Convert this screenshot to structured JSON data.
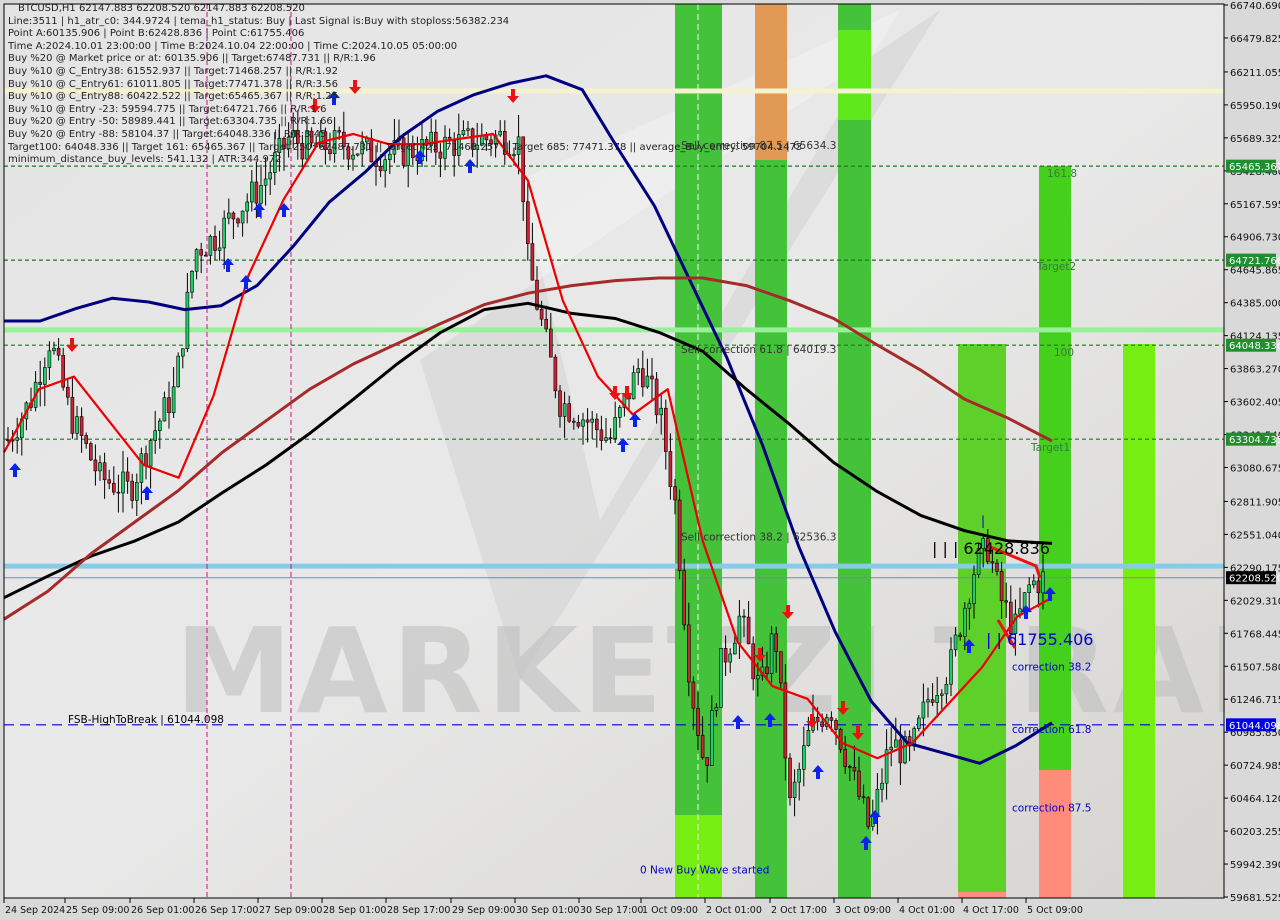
{
  "window": {
    "symbol_line": "BTCUSD,H1  62147.883 62208.520 62147.883 62208.520"
  },
  "info_lines": [
    "Line:3511 | h1_atr_c0: 344.9724 | tema_h1_status: Buy | Last Signal is:Buy with stoploss:56382.234",
    "Point A:60135.906 | Point B:62428.836 | Point C:61755.406",
    "Time A:2024.10.01 23:00:00 | Time B:2024.10.04 22:00:00 | Time C:2024.10.05 05:00:00",
    "Buy %20 @ Market price or at: 60135.906 || Target:67487.731 || R/R:1.96",
    "Buy %10 @ C_Entry38: 61552.937 || Target:71468.257 || R/R:1.92",
    "Buy %10 @ C_Entry61: 61011.805 || Target:77471.378 || R/R:3.56",
    "Buy %10 @ C_Entry88: 60422.522 || Target:65465.367 || R/R:1.25",
    "Buy %10 @ Entry -23: 59594.775 || Target:64721.766 || R/R:1.6",
    "Buy %20 @ Entry -50: 58989.441 || Target:63304.735 || R/R:1.66",
    "Buy %20 @ Entry -88: 58104.37 || Target:64048.336 || R/R:3.45",
    "Target100: 64048.336 || Target 161: 65465.367 || Target 250: 67487.731 || Target 423: 71468.257 || Target 685: 77471.378 || average_Buy_entry: 59704.1473",
    "minimum_distance_buy_levels: 541.132 | ATR:344.972"
  ],
  "chart_data": {
    "type": "candlestick",
    "title": "BTCUSD,H1",
    "symbol": "BTCUSD",
    "timeframe": "H1",
    "ohlc_last": {
      "open": 62147.883,
      "high": 62208.52,
      "low": 62147.883,
      "close": 62208.52
    },
    "ylim": [
      59600,
      66800
    ],
    "y_ticks": [
      "66740.690",
      "66479.825",
      "66211.055",
      "65950.190",
      "65689.325",
      "65428.460",
      "65167.595",
      "64906.730",
      "64645.865",
      "64385.000",
      "64124.135",
      "63863.270",
      "63602.405",
      "63341.540",
      "63080.675",
      "62811.905",
      "62551.040",
      "62290.175",
      "62029.310",
      "61768.445",
      "61507.580",
      "61246.715",
      "60985.850",
      "60724.985",
      "60464.120",
      "60203.255",
      "59942.390",
      "59681.525"
    ],
    "x_ticks": [
      "24 Sep 2024",
      "25 Sep 09:00",
      "26 Sep 01:00",
      "26 Sep 17:00",
      "27 Sep 09:00",
      "28 Sep 01:00",
      "28 Sep 17:00",
      "29 Sep 09:00",
      "30 Sep 01:00",
      "30 Sep 17:00",
      "1 Oct 09:00",
      "2 Oct 01:00",
      "2 Oct 17:00",
      "3 Oct 09:00",
      "4 Oct 01:00",
      "4 Oct 17:00",
      "5 Oct 09:00"
    ],
    "price_labels": [
      {
        "value": 65465.367,
        "text": "65465.367",
        "color": "#1f8f2e"
      },
      {
        "value": 64721.766,
        "text": "64721.766",
        "color": "#1f8f2e"
      },
      {
        "value": 64048.336,
        "text": "64048.336",
        "color": "#1f8f2e"
      },
      {
        "value": 63304.735,
        "text": "63304.735",
        "color": "#1f8f2e"
      },
      {
        "value": 62208.52,
        "text": "62208.520",
        "color": "#000000"
      },
      {
        "value": 61044.098,
        "text": "61044.098",
        "color": "#0000ee"
      }
    ],
    "horizontal_lines": [
      {
        "name": "target-161",
        "value": 65465.367,
        "style": "dashed",
        "color": "#1a7a1a"
      },
      {
        "name": "target-2",
        "value": 64721.766,
        "style": "dashed",
        "color": "#1a7a1a"
      },
      {
        "name": "target-100",
        "value": 64048.336,
        "style": "dashed",
        "color": "#1a7a1a"
      },
      {
        "name": "target-1",
        "value": 63304.735,
        "style": "dashed",
        "color": "#1a7a1a"
      },
      {
        "name": "fsb-high-to-break",
        "value": 61044.098,
        "style": "dashed",
        "color": "#0000cc"
      },
      {
        "name": "current-price",
        "value": 62208.52,
        "style": "solid",
        "color": "#7788aa"
      },
      {
        "name": "cream-level",
        "value": 66060,
        "style": "thick",
        "color": "#f5f2d0"
      },
      {
        "name": "lightgreen-level",
        "value": 64170,
        "style": "thick",
        "color": "#98f098"
      },
      {
        "name": "skyblue-level",
        "value": 62300,
        "style": "thick",
        "color": "#87cbe8"
      }
    ],
    "annotations": [
      {
        "text": "Sell correction 87.5 | 65634.3",
        "value": 65634.3,
        "color": "#333333"
      },
      {
        "text": "Sell correction 61.8 | 64019.3",
        "value": 64019.3,
        "color": "#333333"
      },
      {
        "text": "Sell correction 38.2 | 62536.3",
        "value": 62536.3,
        "color": "#333333"
      },
      {
        "text": "161.8",
        "value": 65465.367,
        "color": "#3a7a3a"
      },
      {
        "text": "Target2",
        "value": 64721.766,
        "color": "#3a7a3a"
      },
      {
        "text": "100",
        "value": 64048.336,
        "color": "#3a7a3a"
      },
      {
        "text": "Target1",
        "value": 63304.735,
        "color": "#3a7a3a"
      },
      {
        "text": "| | | 62428.836",
        "value": 62428.836,
        "color": "#000000"
      },
      {
        "text": "| | 61755.406",
        "value": 61755.406,
        "color": "#0000cc"
      },
      {
        "text": "correction 38.2",
        "value": 61552.937,
        "color": "#0000cc"
      },
      {
        "text": "correction 61.8",
        "value": 61011.805,
        "color": "#0000cc"
      },
      {
        "text": "correction 87.5",
        "value": 60422.522,
        "color": "#0000cc"
      },
      {
        "text": "FSB-HighToBreak | 61044.098",
        "value": 61044.098,
        "color": "#000000"
      },
      {
        "text": "0 New Buy Wave started",
        "value": 59900,
        "color": "#0000cc"
      }
    ],
    "series": [
      {
        "name": "ma-blue",
        "color": "#000080",
        "values": [
          64240,
          64240,
          64340,
          64420,
          64390,
          64330,
          64360,
          64520,
          64830,
          65180,
          65420,
          65700,
          65900,
          66030,
          66120,
          66180,
          66070,
          65600,
          65150,
          64550,
          63950,
          63250,
          62450,
          61780,
          61230,
          60900,
          60820,
          60740,
          60880,
          61060
        ]
      },
      {
        "name": "ma-black",
        "color": "#000000",
        "values": [
          62050,
          62220,
          62380,
          62500,
          62650,
          62880,
          63100,
          63350,
          63620,
          63900,
          64150,
          64330,
          64380,
          64300,
          64260,
          64150,
          64000,
          63700,
          63420,
          63120,
          62890,
          62700,
          62580,
          62500,
          62480
        ]
      },
      {
        "name": "ma-brown",
        "color": "#a52a2a",
        "values": [
          61880,
          62100,
          62400,
          62650,
          62900,
          63200,
          63450,
          63700,
          63900,
          64060,
          64220,
          64370,
          64460,
          64520,
          64560,
          64580,
          64580,
          64520,
          64400,
          64260,
          64050,
          63850,
          63620,
          63470,
          63290
        ]
      },
      {
        "name": "ma-red",
        "color": "#ee0000",
        "values": [
          63200,
          63700,
          63800,
          63450,
          63100,
          63000,
          63650,
          64600,
          65200,
          65650,
          65720,
          65640,
          65640,
          65680,
          65720,
          65350,
          64400,
          63800,
          63500,
          63700,
          62500,
          61700,
          61350,
          61250,
          60900,
          60780,
          60900,
          61200,
          61500,
          61900,
          62050
        ]
      }
    ],
    "candles_note": "hourly BTCUSD candles approx range 59800-66400 over 24 Sep - 5 Oct 2024"
  }
}
